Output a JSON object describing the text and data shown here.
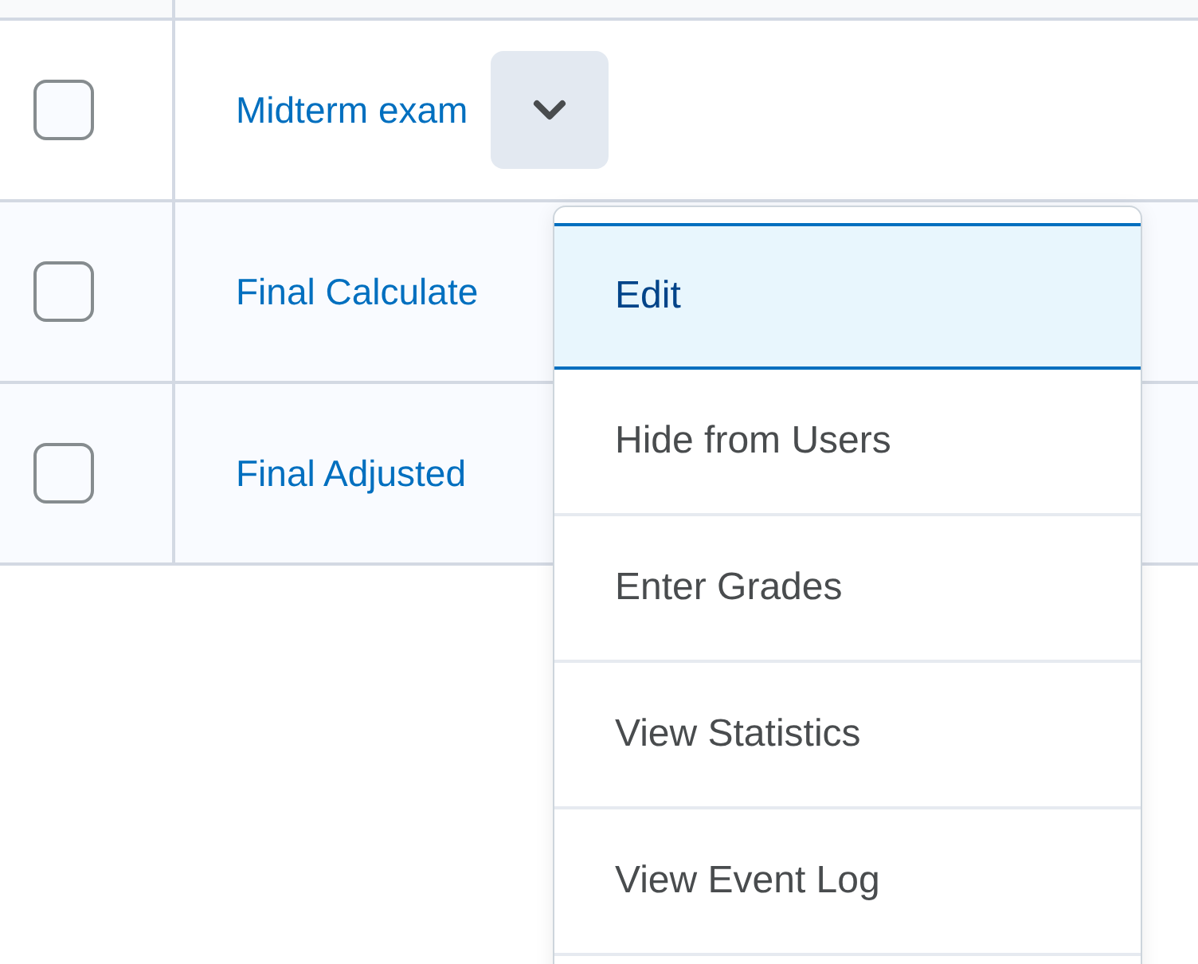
{
  "table": {
    "rows": [
      {
        "checked": false,
        "title": "Midterm exam",
        "has_menu_button": true
      },
      {
        "checked": false,
        "title": "Final Calculate",
        "has_menu_button": false
      },
      {
        "checked": false,
        "title": "Final Adjusted",
        "has_menu_button": false
      }
    ]
  },
  "menu": {
    "items": [
      {
        "label": "Edit",
        "selected": true
      },
      {
        "label": "Hide from Users",
        "selected": false
      },
      {
        "label": "Enter Grades",
        "selected": false
      },
      {
        "label": "View Statistics",
        "selected": false
      },
      {
        "label": "View Event Log",
        "selected": false
      }
    ]
  }
}
